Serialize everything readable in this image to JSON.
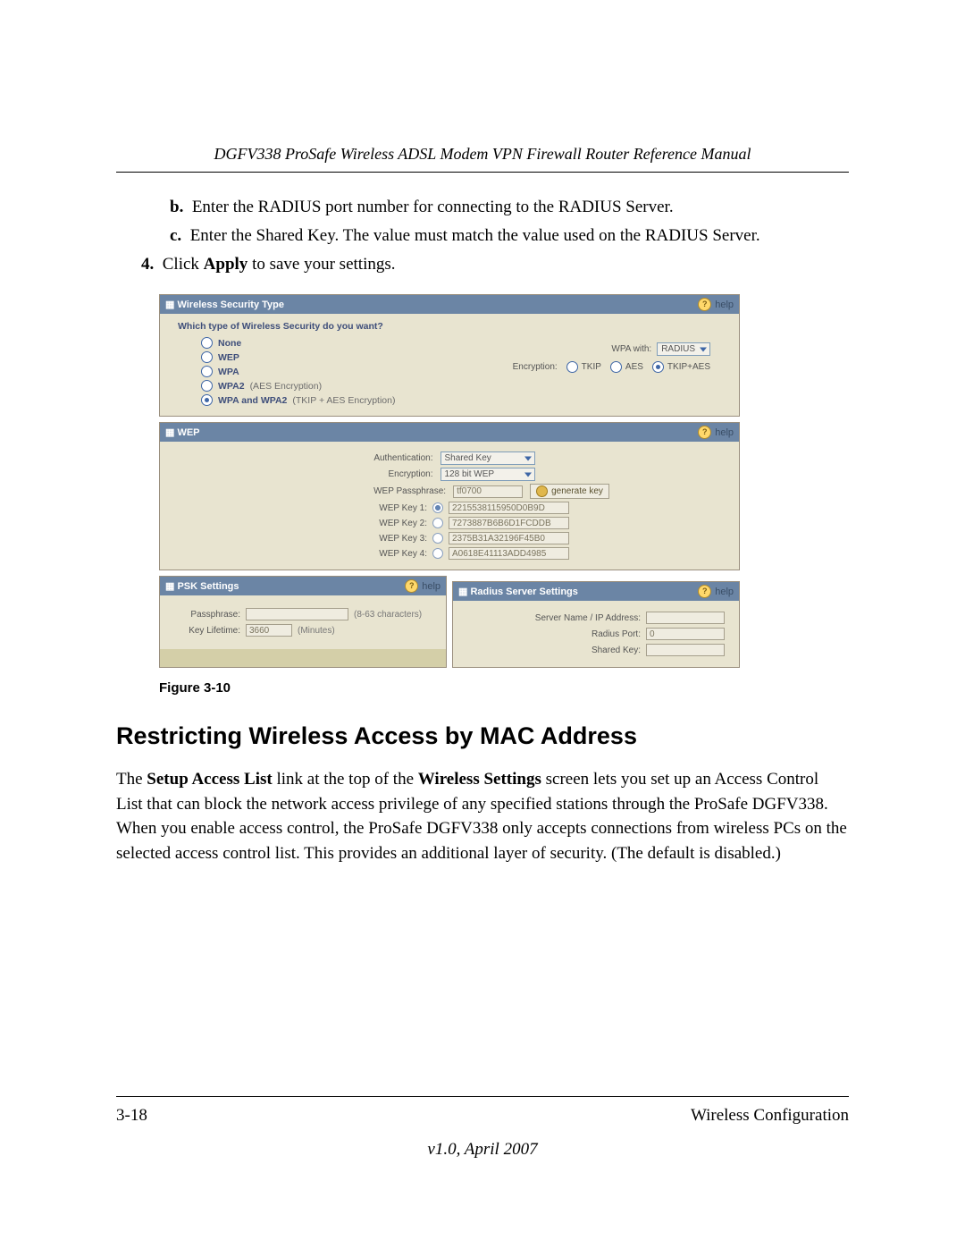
{
  "header": {
    "title": "DGFV338 ProSafe Wireless ADSL Modem VPN Firewall Router Reference Manual"
  },
  "steps": {
    "b": {
      "marker": "b.",
      "text": "Enter the RADIUS port number for connecting to the RADIUS Server."
    },
    "c": {
      "marker": "c.",
      "text": "Enter the Shared Key. The value must match the value used on the RADIUS Server."
    },
    "s4": {
      "marker": "4.",
      "pre": "Click ",
      "bold": "Apply",
      "post": " to save your settings."
    }
  },
  "figure": {
    "caption": "Figure 3-10",
    "help_label": "help",
    "sec1": {
      "title": "Wireless Security Type",
      "question": "Which type of Wireless Security do you want?",
      "opts": {
        "none": "None",
        "wep": "WEP",
        "wpa": "WPA",
        "wpa2": "WPA2",
        "wpa2_sub": "(AES Encryption)",
        "both": "WPA and WPA2",
        "both_sub": "(TKIP + AES Encryption)"
      },
      "wpa_with_lbl": "WPA with:",
      "wpa_with_val": "RADIUS",
      "enc_lbl": "Encryption:",
      "enc_tkip": "TKIP",
      "enc_aes": "AES",
      "enc_both": "TKIP+AES"
    },
    "sec2": {
      "title": "WEP",
      "auth_lbl": "Authentication:",
      "auth_val": "Shared Key",
      "enc_lbl": "Encryption:",
      "enc_val": "128 bit WEP",
      "pass_lbl": "WEP Passphrase:",
      "pass_val": "tf0700",
      "genkey": "generate key",
      "k1_lbl": "WEP Key 1:",
      "k1_val": "2215538115950D0B9D",
      "k2_lbl": "WEP Key 2:",
      "k2_val": "7273887B6B6D1FCDDB",
      "k3_lbl": "WEP Key 3:",
      "k3_val": "2375B31A32196F45B0",
      "k4_lbl": "WEP Key 4:",
      "k4_val": "A0618E41113ADD4985"
    },
    "sec3": {
      "title": "PSK Settings",
      "pass_lbl": "Passphrase:",
      "pass_unit": "(8-63 characters)",
      "life_lbl": "Key Lifetime:",
      "life_val": "3660",
      "life_unit": "(Minutes)"
    },
    "sec4": {
      "title": "Radius Server Settings",
      "srv_lbl": "Server Name / IP Address:",
      "port_lbl": "Radius Port:",
      "port_val": "0",
      "key_lbl": "Shared Key:"
    }
  },
  "section": {
    "heading": "Restricting Wireless Access by MAC Address",
    "para_parts": {
      "t0": "The ",
      "b1": "Setup Access List",
      "t1": " link at the top of the ",
      "b2": "Wireless Settings",
      "t2": " screen lets you set up an Access Control List that can block the network access privilege of any specified stations through the ProSafe DGFV338. When you enable access control, the ProSafe DGFV338 only accepts connections from wireless PCs on the selected access control list. This provides an additional layer of security. (The default is disabled.)"
    }
  },
  "footer": {
    "page": "3-18",
    "chapter": "Wireless Configuration",
    "version": "v1.0, April 2007"
  }
}
